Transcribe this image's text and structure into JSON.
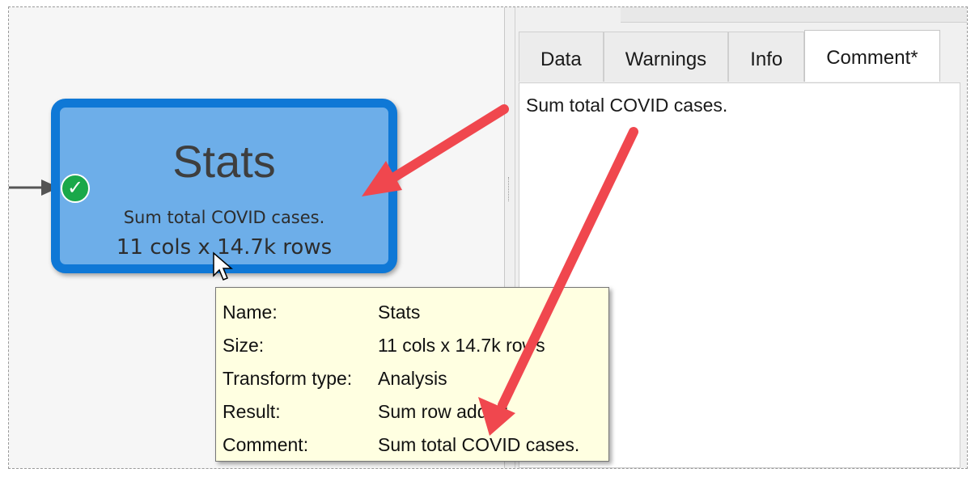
{
  "tabs": [
    {
      "label": "Data"
    },
    {
      "label": "Warnings"
    },
    {
      "label": "Info"
    },
    {
      "label": "Comment*"
    }
  ],
  "active_tab": "Comment*",
  "comment_text": "Sum total COVID cases.",
  "node": {
    "title": "Stats",
    "comment": "Sum total COVID cases.",
    "size": "11 cols x 14.7k rows",
    "status_icon": "checkmark-icon",
    "border_color": "#0f78d6",
    "fill_color": "#6daee9"
  },
  "tooltip": {
    "rows": [
      {
        "key": "Name:",
        "value": "Stats"
      },
      {
        "key": "Size:",
        "value": "11 cols x 14.7k rows"
      },
      {
        "key": "Transform type:",
        "value": "Analysis"
      },
      {
        "key": "Result:",
        "value": "Sum row added"
      },
      {
        "key": "Comment:",
        "value": "Sum total COVID cases."
      }
    ]
  },
  "annotation_color": "#f0474e"
}
